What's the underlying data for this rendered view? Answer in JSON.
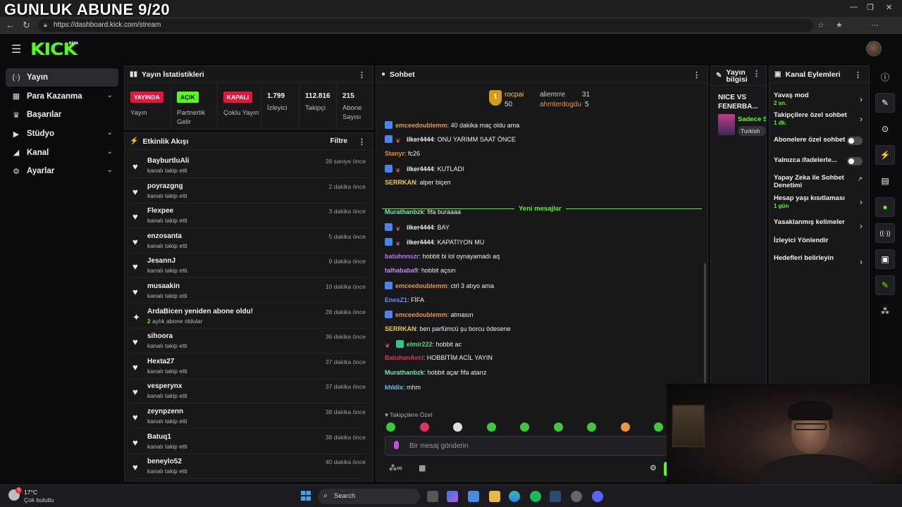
{
  "overlay_title": "GUNLUK ABUNE 9/20",
  "browser": {
    "url": "https://dashboard.kick.com/stream",
    "window_controls": [
      "minimize-icon",
      "restore-icon",
      "close-icon"
    ]
  },
  "app": {
    "logo": "KICK",
    "beta": "BETA"
  },
  "sidebar": {
    "items": [
      {
        "label": "Yayın",
        "icon": "broadcast-icon",
        "glyph": "(·)",
        "active": true,
        "chevron": false
      },
      {
        "label": "Para Kazanma",
        "icon": "money-icon",
        "glyph": "▦",
        "active": false,
        "chevron": true
      },
      {
        "label": "Başarılar",
        "icon": "trophy-icon",
        "glyph": "♛",
        "active": false,
        "chevron": false
      },
      {
        "label": "Stüdyo",
        "icon": "studio-icon",
        "glyph": "▶",
        "active": false,
        "chevron": true
      },
      {
        "label": "Kanal",
        "icon": "channel-icon",
        "glyph": "◢",
        "active": false,
        "chevron": true
      },
      {
        "label": "Ayarlar",
        "icon": "gear-icon",
        "glyph": "⚙",
        "active": false,
        "chevron": true
      }
    ]
  },
  "stats": {
    "title": "Yayın İstatistikleri",
    "status": [
      {
        "badge": "YAYINDA",
        "color": "#e3173e",
        "label": "Yayın"
      },
      {
        "badge": "AÇIK",
        "color": "#53fc18",
        "label": "Partnerlik Gelir"
      },
      {
        "badge": "KAPALI",
        "color": "#e3173e",
        "label": "Çoklu Yayın"
      }
    ],
    "numbers": [
      {
        "value": "1.799",
        "label": "İzleyici"
      },
      {
        "value": "112.816",
        "label": "Takipçi"
      },
      {
        "value": "215",
        "label": "Abone Sayısı"
      }
    ]
  },
  "activity": {
    "title": "Etkinlik Akışı",
    "filter_label": "Filtre",
    "items": [
      {
        "name": "BayburtluAli",
        "desc": "kanalı takip etti",
        "time": "28 saniye önce",
        "icon": "heart-icon"
      },
      {
        "name": "poyrazgng",
        "desc": "kanalı takip etti",
        "time": "2 dakika önce",
        "icon": "heart-icon"
      },
      {
        "name": "Flexpee",
        "desc": "kanalı takip etti",
        "time": "3 dakika önce",
        "icon": "heart-icon"
      },
      {
        "name": "enzosanta",
        "desc": "kanalı takip etti",
        "time": "5 dakika önce",
        "icon": "heart-icon"
      },
      {
        "name": "JesannJ",
        "desc": "kanalı takip etti",
        "time": "9 dakika önce",
        "icon": "heart-icon"
      },
      {
        "name": "musaakin",
        "desc": "kanalı takip etti",
        "time": "10 dakika önce",
        "icon": "heart-icon"
      },
      {
        "name": "ArdaBicen yeniden abone oldu!",
        "desc_highlight": "2",
        "desc": "aylık abone oldular",
        "time": "28 dakika önce",
        "icon": "sparkle-icon"
      },
      {
        "name": "sihoora",
        "desc": "kanalı takip etti",
        "time": "36 dakika önce",
        "icon": "heart-icon"
      },
      {
        "name": "Hexta27",
        "desc": "kanalı takip etti",
        "time": "37 dakika önce",
        "icon": "heart-icon"
      },
      {
        "name": "vesperynx",
        "desc": "kanalı takip etti",
        "time": "37 dakika önce",
        "icon": "heart-icon"
      },
      {
        "name": "zeynpzenn",
        "desc": "kanalı takip etti",
        "time": "38 dakika önce",
        "icon": "heart-icon"
      },
      {
        "name": "Batuq1",
        "desc": "kanalı takip etti",
        "time": "38 dakika önce",
        "icon": "heart-icon"
      },
      {
        "name": "beneylo52",
        "desc": "kanalı takip etti",
        "time": "40 dakika önce",
        "icon": "heart-icon"
      }
    ]
  },
  "chat": {
    "title": "Sohbet",
    "leaderboard": [
      {
        "rank": "1",
        "name": "rocpai",
        "value": "50"
      },
      {
        "name": "aliemrre",
        "value": "31"
      },
      {
        "name": "ahmterdogdu",
        "value": "5"
      }
    ],
    "messages": [
      {
        "user": "emceedoublemm",
        "color": "#e9954a",
        "badges": [
          "blue"
        ],
        "text": ": 40 dakika maç oldu ama"
      },
      {
        "user": "ilker4444",
        "color": "#f0f0f0",
        "badges": [
          "blue",
          "leaf"
        ],
        "text": ": ONU YARIMM SAAT ÖNCE"
      },
      {
        "user": "Stanyr",
        "color": "#ef8a3a",
        "badges": [],
        "text": ": fc26"
      },
      {
        "user": "ilker4444",
        "color": "#f0f0f0",
        "badges": [
          "blue",
          "leaf"
        ],
        "text": ": KUTLADI"
      },
      {
        "user": "SERRKAN",
        "color": "#f2c94c",
        "badges": [],
        "text": ": alper biçen"
      },
      {
        "user": "Murathanbzk",
        "color": "#7fe0b4",
        "badges": [],
        "text": ": fifa buraaaa"
      },
      {
        "user": "ilker4444",
        "color": "#f0f0f0",
        "badges": [
          "blue",
          "leaf"
        ],
        "text": ": BAY"
      },
      {
        "user": "ilker4444",
        "color": "#f0f0f0",
        "badges": [
          "blue",
          "leaf"
        ],
        "text": ": KAPATIYON MU"
      },
      {
        "user": "batuhnnszr",
        "color": "#b877f2",
        "badges": [],
        "text": ": hobbit bi lol oynayamadı aq"
      },
      {
        "user": "talhababa9",
        "color": "#c58af0",
        "badges": [],
        "text": ": hobbit açsın"
      },
      {
        "user": "emceedoublemm",
        "color": "#e9954a",
        "badges": [
          "blue"
        ],
        "text": ": ctrl 3 atıyo ama"
      },
      {
        "user": "EnesZ1",
        "color": "#6c8cf0",
        "badges": [],
        "text": ": FİFA"
      },
      {
        "user": "emceedoublemm",
        "color": "#e9954a",
        "badges": [
          "blue"
        ],
        "text": ": atmasın"
      },
      {
        "user": "SERRKAN",
        "color": "#f2c94c",
        "badges": [],
        "text": ": ben parfümcü şu borcu ödesene"
      },
      {
        "user": "elmir222",
        "color": "#6cd07a",
        "badges": [
          "leaf",
          "mint"
        ],
        "text": ": hobbit ac"
      },
      {
        "user": "BatuhanAvci",
        "color": "#e0335a",
        "badges": [],
        "text": ": HOBBİTİM ACİL YAYIN"
      },
      {
        "user": "Murathanbzk",
        "color": "#7fe0b4",
        "badges": [],
        "text": ": hobbit açar fifa atarız"
      },
      {
        "user": "khldix",
        "color": "#6fc7ea",
        "badges": [],
        "text": ": mhm"
      }
    ],
    "new_messages_label": "Yeni mesajlar",
    "followers_only": "Takipçilere Özel",
    "input_placeholder": "Bir mesaj gönderin"
  },
  "stream_info": {
    "title": "Yayın bilgisi",
    "stream_title": "NICE VS FENERBA...",
    "category": "Sadece Sohbet",
    "tag": "Turkish"
  },
  "actions": {
    "title": "Kanal Eylemleri",
    "items": [
      {
        "label": "Yavaş mod",
        "sub": "2 sn.",
        "kind": "arrow"
      },
      {
        "label": "Takipçilere özel sohbet",
        "sub": "1 dk.",
        "kind": "arrow"
      },
      {
        "label": "Abonelere özel sohbet",
        "sub": "",
        "kind": "toggle"
      },
      {
        "label": "Yalnızca ifadelerle...",
        "sub": "",
        "kind": "toggle"
      },
      {
        "label": "Yapay Zeka ile Sohbet Denetimi",
        "sub": "",
        "kind": "external"
      },
      {
        "label": "Hesap yaşı kısıtlaması",
        "sub": "1 gün",
        "kind": "arrow"
      },
      {
        "label": "Yasaklanmış kelimeler",
        "sub": "",
        "kind": "arrow"
      },
      {
        "label": "İzleyici Yönlendir",
        "sub": "",
        "kind": "none"
      },
      {
        "label": "Hedefleri belirleyin",
        "sub": "",
        "kind": "arrow"
      }
    ]
  },
  "rail": [
    {
      "icon": "info-icon",
      "glyph": "ⓘ",
      "style": "plain"
    },
    {
      "icon": "edit-icon",
      "glyph": "✎",
      "style": "hl"
    },
    {
      "icon": "camera-icon",
      "glyph": "⊙",
      "style": "plain"
    },
    {
      "icon": "bolt-icon",
      "glyph": "⚡",
      "style": "hl-green"
    },
    {
      "icon": "notes-icon",
      "glyph": "▤",
      "style": "plain"
    },
    {
      "icon": "chat-icon",
      "glyph": "●",
      "style": "hl-green"
    },
    {
      "icon": "broadcast-icon",
      "glyph": "((·))",
      "style": "hl"
    },
    {
      "icon": "card-icon",
      "glyph": "▣",
      "style": "hl"
    },
    {
      "icon": "wrench-icon",
      "glyph": "✎",
      "style": "hl-green"
    },
    {
      "icon": "emote-icon",
      "glyph": "⁂",
      "style": "plain"
    }
  ],
  "taskbar": {
    "weather_temp": "17°C",
    "weather_desc": "Çok bulutlu",
    "weather_badge": "9",
    "search_label": "Search"
  }
}
